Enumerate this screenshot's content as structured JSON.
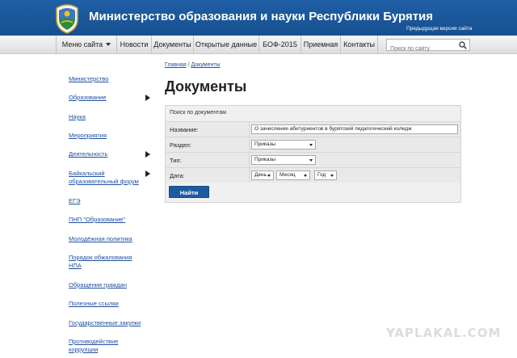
{
  "header": {
    "title": "Министерство образования и науки Республики Бурятия",
    "prev_version_link": "Предыдущая версия сайта",
    "brand_color": "#1f5fa6"
  },
  "nav": {
    "menu_label": "Меню сайта",
    "items": [
      "Новости",
      "Документы",
      "Открытые данные",
      "БОФ-2015",
      "Приемная",
      "Контакты"
    ],
    "search_placeholder": "Поиск по сайту"
  },
  "sidebar": {
    "items": [
      {
        "label": "Министерство",
        "has_submenu": false
      },
      {
        "label": "Образование",
        "has_submenu": true
      },
      {
        "label": "Наука",
        "has_submenu": false
      },
      {
        "label": "Мероприятия",
        "has_submenu": false
      },
      {
        "label": "Деятельность",
        "has_submenu": true
      },
      {
        "label": "Байкальский образовательный форум",
        "has_submenu": true
      },
      {
        "label": "ЕГЭ",
        "has_submenu": false
      },
      {
        "label": "ПНП \"Образование\"",
        "has_submenu": false
      },
      {
        "label": "Молодёжная политика",
        "has_submenu": false
      },
      {
        "label": "Порядок обжалования НПА",
        "has_submenu": false
      },
      {
        "label": "Обращения граждан",
        "has_submenu": false
      },
      {
        "label": "Полезные ссылки",
        "has_submenu": false
      },
      {
        "label": "Государственные закупки",
        "has_submenu": false
      },
      {
        "label": "Противодействие коррупции",
        "has_submenu": false
      }
    ]
  },
  "breadcrumb": {
    "home": "Главная",
    "separator": " / ",
    "current": "Документы"
  },
  "page": {
    "title": "Документы"
  },
  "search_form": {
    "caption": "Поиск по документам",
    "name_label": "Название:",
    "name_value": "О зачислении абитуриентов в бурятский педагогический коледж",
    "section_label": "Раздел:",
    "section_value": "Приказы",
    "type_label": "Тип:",
    "type_value": "Приказы",
    "date_label": "Дата:",
    "day_value": "День",
    "month_value": "Месяц",
    "year_value": "Год",
    "submit_label": "Найти"
  },
  "watermark": "YAPLAKAL.COM"
}
